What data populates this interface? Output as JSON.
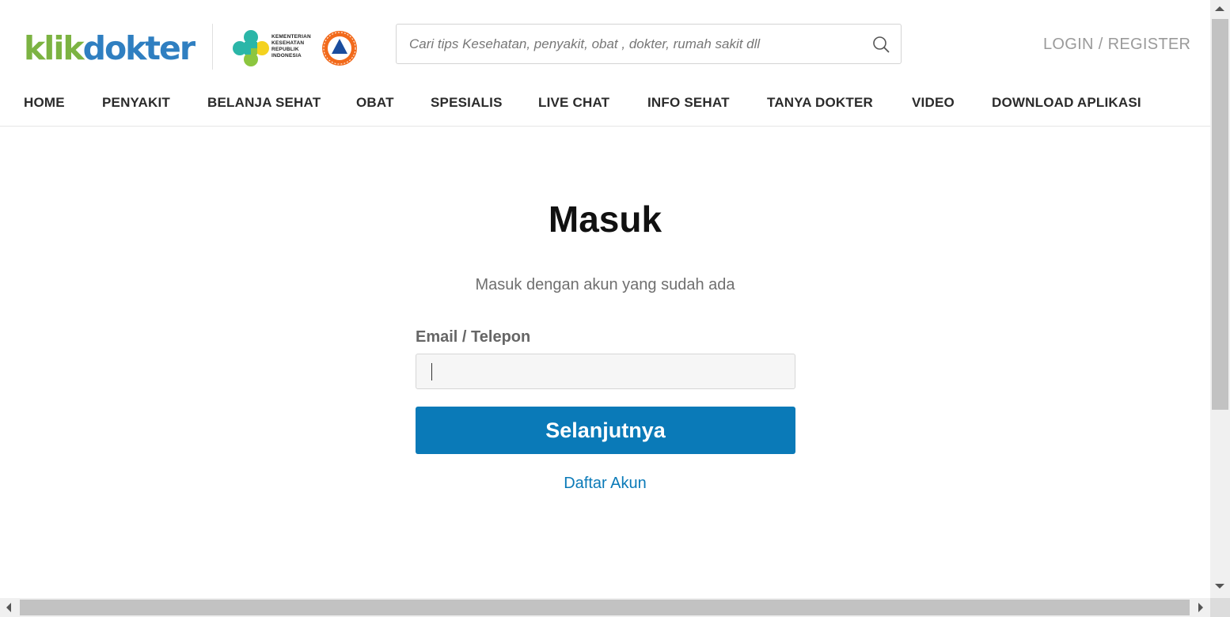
{
  "header": {
    "logo": {
      "part1": "klik",
      "part2": "dokter"
    },
    "partner_logo_text": [
      "KEMENTERIAN",
      "KESEHATAN",
      "REPUBLIK",
      "INDONESIA"
    ],
    "search": {
      "placeholder": "Cari tips Kesehatan, penyakit, obat , dokter, rumah sakit dll",
      "value": "",
      "icon": "search-icon"
    },
    "login": {
      "login_label": "LOGIN",
      "separator": "/",
      "register_label": "REGISTER"
    },
    "nav": [
      {
        "label": "HOME"
      },
      {
        "label": "PENYAKIT"
      },
      {
        "label": "BELANJA SEHAT"
      },
      {
        "label": "OBAT"
      },
      {
        "label": "SPESIALIS"
      },
      {
        "label": "LIVE CHAT"
      },
      {
        "label": "INFO SEHAT"
      },
      {
        "label": "TANYA DOKTER"
      },
      {
        "label": "VIDEO"
      },
      {
        "label": "DOWNLOAD APLIKASI"
      }
    ]
  },
  "main": {
    "title": "Masuk",
    "subtitle": "Masuk dengan akun yang sudah ada",
    "field_label": "Email / Telepon",
    "field_value": "",
    "submit_label": "Selanjutnya",
    "register_link": "Daftar Akun"
  },
  "colors": {
    "primary_button": "#0a7ab8",
    "logo_green": "#7cb342",
    "logo_blue": "#2f7fc1",
    "link": "#0a7ab8"
  }
}
